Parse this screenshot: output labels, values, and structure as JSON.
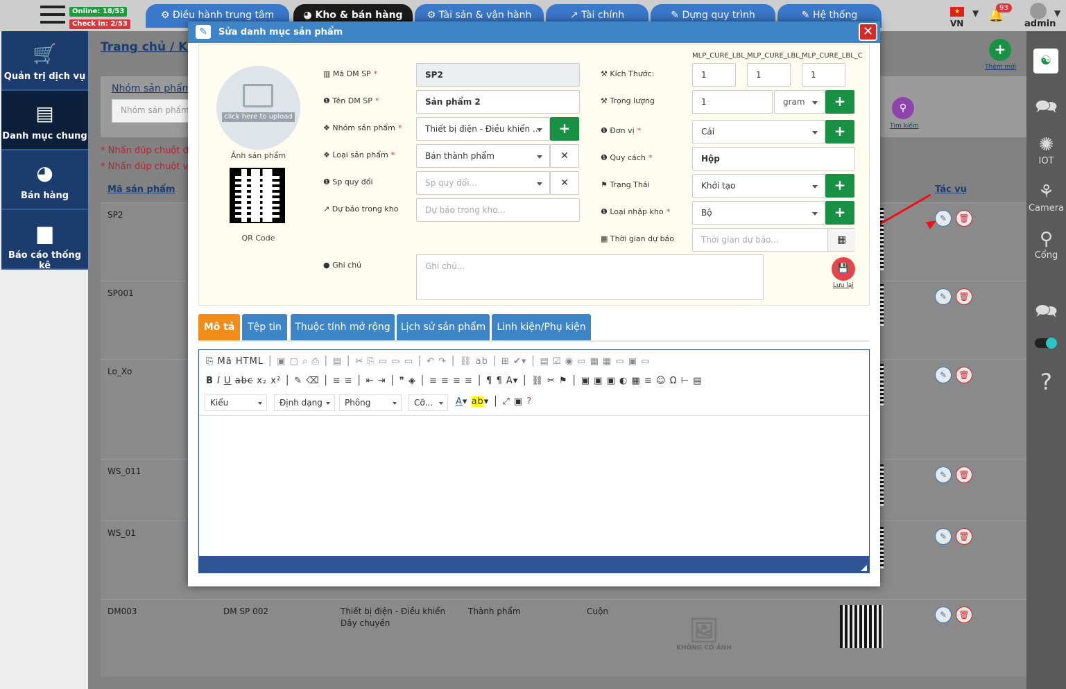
{
  "topbar": {
    "online": "Online: 18/53",
    "checkin": "Check in: 2/53",
    "tabs": [
      {
        "label": "⚙ Điều hành trung tâm"
      },
      {
        "label": "◕ Kho & bán hàng"
      },
      {
        "label": "⚙ Tài sản & vận hành"
      },
      {
        "label": "↗ Tài chính"
      },
      {
        "label": "✎ Dựng quy trình"
      },
      {
        "label": "✎ Hệ thống"
      }
    ],
    "lang": "VN",
    "notif_count": "93",
    "user": "admin"
  },
  "leftnav": [
    {
      "label": "Quản trị dịch vụ",
      "icon": "cart-icon"
    },
    {
      "label": "Danh mục chung",
      "icon": "list-icon"
    },
    {
      "label": "Bán hàng",
      "icon": "pie-chart-icon"
    },
    {
      "label": "Báo cáo thống kê",
      "icon": "folder-icon"
    }
  ],
  "rightnav": [
    {
      "label": "",
      "icon": "video-chat-icon"
    },
    {
      "label": "IOT",
      "icon": "iot-icon"
    },
    {
      "label": "Camera",
      "icon": "camera-icon"
    },
    {
      "label": "Cổng",
      "icon": "gate-icon"
    }
  ],
  "page": {
    "breadcrumb": "Trang chủ / Kho",
    "filter_label": "Nhóm sản phẩm",
    "filter_placeholder": "Nhóm sản phẩm",
    "note1": "* Nhấn đúp chuột để",
    "note2": "* Nhấn đúp chuột và",
    "col_code": "Mã sản phẩm",
    "col_action": "Tác vụ",
    "add_new": "Thêm mới",
    "search": "Tìm kiếm",
    "no_image": "KHÔNG CÓ ẢNH"
  },
  "rows": [
    {
      "code": "SP2"
    },
    {
      "code": "SP001"
    },
    {
      "code": "Lo_Xo"
    },
    {
      "code": "WS_011"
    },
    {
      "code": "WS_01"
    },
    {
      "code": "DM003",
      "name": "DM SP 002",
      "group": "Thiết bị điện - Điều khiển",
      "group2": "Dây chuyền",
      "type": "Thành phẩm",
      "unit": "Cuộn"
    }
  ],
  "modal": {
    "title": "Sửa danh mục sản phẩm",
    "upload_hint": "click here to upload",
    "image_caption": "Ảnh sản phẩm",
    "qr_caption": "QR Code",
    "fields": {
      "code_label": "Mã DM SP",
      "code_value": "SP2",
      "name_label": "Tên DM SP",
      "name_value": "Sản phẩm 2",
      "group_label": "Nhóm sản phẩm",
      "group_value": "Thiết bị điện - Điều khiển ...",
      "type_label": "Loại sản phẩm",
      "type_value": "Bán thành phẩm",
      "convert_label": "Sp quy đổi",
      "convert_placeholder": "Sp quy đổi...",
      "forecast_label": "Dự báo trong kho",
      "forecast_placeholder": "Dự báo trong kho...",
      "note_label": "Ghi chú",
      "note_placeholder": "Ghi chú...",
      "size_label": "Kích Thước:",
      "size_headers": [
        "MLP_CURE_LBL_",
        "MLP_CURE_LBL_",
        "MLP_CURE_LBL_C"
      ],
      "size_values": [
        "1",
        "1",
        "1"
      ],
      "weight_label": "Trọng lượng",
      "weight_value": "1",
      "weight_unit": "gram",
      "unit_label": "Đơn vị",
      "unit_value": "Cái",
      "spec_label": "Quy cách",
      "spec_value": "Hộp",
      "status_label": "Trạng Thái",
      "status_value": "Khởi tạo",
      "import_label": "Loại nhập kho",
      "import_value": "Bộ",
      "forecast_time_label": "Thời gian dự báo",
      "forecast_time_placeholder": "Thời gian dự báo...",
      "save_label": "Lưu lại"
    },
    "tabs": [
      "Mô tả",
      "Tệp tin",
      "Thuộc tính mở rộng",
      "Lịch sử sản phẩm",
      "Linh kiện/Phụ kiện"
    ],
    "editor": {
      "source_label": "Mã HTML",
      "style_dd": "Kiểu",
      "format_dd": "Định dạng",
      "font_dd": "Phông",
      "size_dd": "Cỡ..."
    }
  },
  "colors": {
    "accent": "#3d85c6",
    "active_tab": "#f28c19",
    "green": "#189144",
    "danger": "#d32a2a"
  }
}
